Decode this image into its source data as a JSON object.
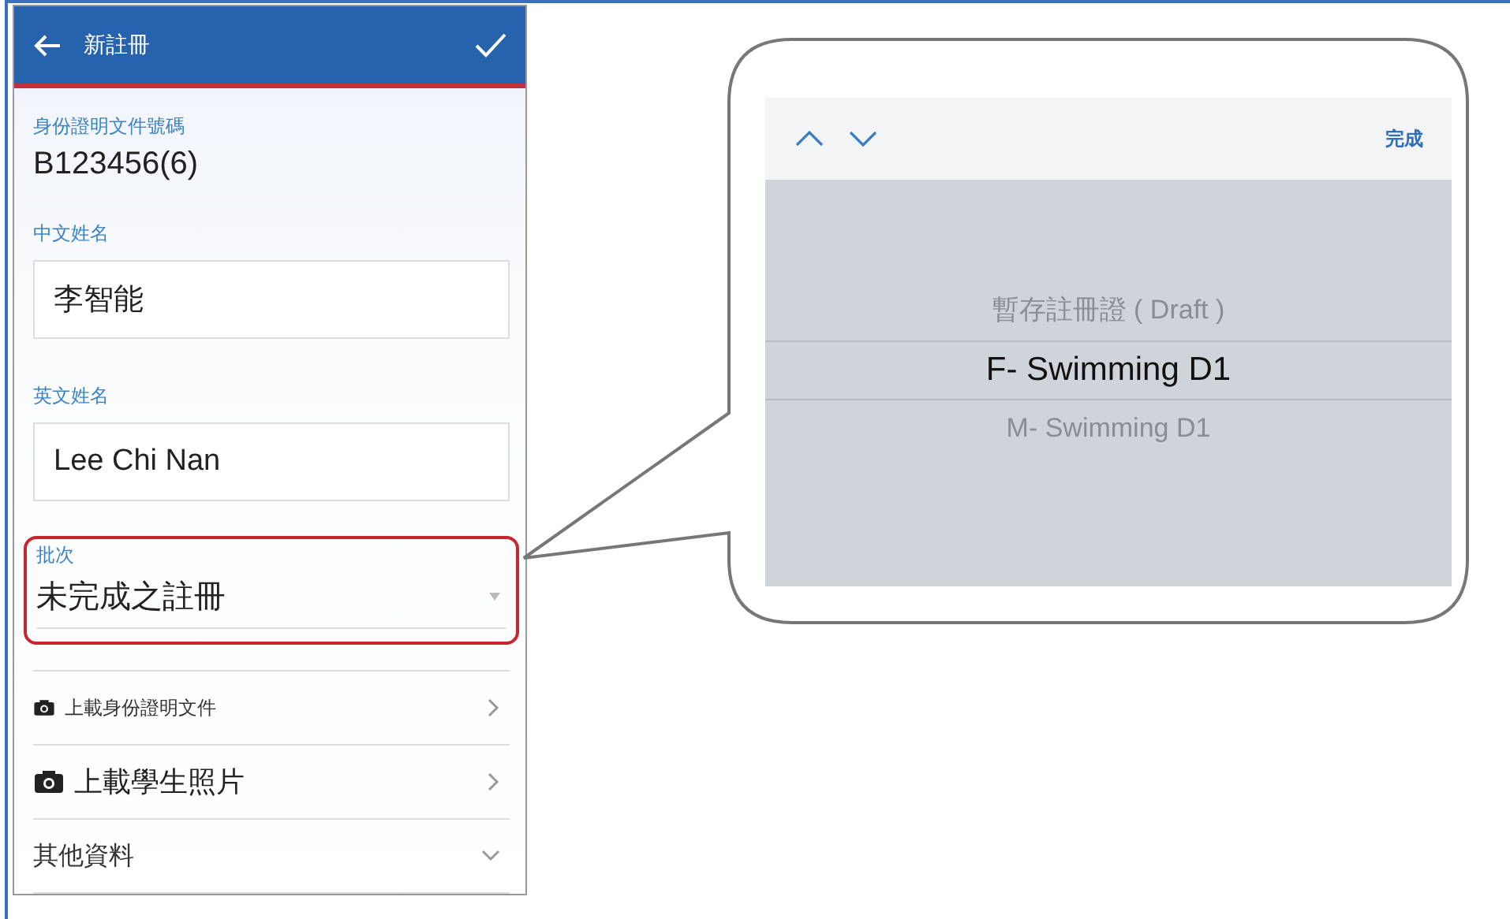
{
  "header": {
    "title": "新註冊"
  },
  "id_field": {
    "label": "身份證明文件號碼",
    "value": "B123456(6)"
  },
  "fields": [
    {
      "label": "中文姓名",
      "value": "李智能"
    },
    {
      "label": "英文姓名",
      "value": "Lee Chi Nan"
    }
  ],
  "batch_select": {
    "label": "批次",
    "value": "未完成之註冊",
    "highlighted": true
  },
  "menu_rows": [
    {
      "label": "上載身份證明文件",
      "kind": "upload-small"
    },
    {
      "label": "上載學生照片",
      "kind": "upload"
    },
    {
      "label": "其他資料",
      "kind": "expand"
    }
  ],
  "picker": {
    "done": "完成",
    "options": [
      {
        "label": "暫存註冊證 ( Draft )",
        "selected": false
      },
      {
        "label": "F- Swimming D1",
        "selected": true
      },
      {
        "label": "M- Swimming D1",
        "selected": false
      }
    ]
  }
}
